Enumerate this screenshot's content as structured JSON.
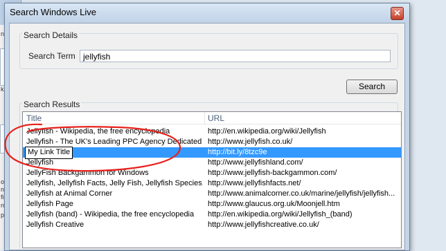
{
  "background_window": {
    "fragments": [
      "ndo",
      "k",
      "on",
      "ns",
      "fic",
      "ror",
      "pec"
    ]
  },
  "dialog": {
    "title": "Search Windows Live",
    "close_glyph": "✕"
  },
  "search_details": {
    "group_label": "Search Details",
    "term_label": "Search Term",
    "term_value": "jellyfish"
  },
  "search_button": {
    "label": "Search"
  },
  "search_results": {
    "group_label": "Search Results",
    "columns": [
      "Title",
      "URL"
    ],
    "rows": [
      {
        "title": "Jellyfish - Wikipedia, the free encyclopedia",
        "url": "http://en.wikipedia.org/wiki/Jellyfish"
      },
      {
        "title": "Jellyfish - The UK's Leading PPC Agency Dedicated to...",
        "url": "http://www.jellyfish.co.uk/"
      },
      {
        "title": "My Link Title",
        "url": "http://bit.ly/8tzc9e"
      },
      {
        "title": "Jellyfish",
        "url": "http://www.jellyfishland.com/"
      },
      {
        "title": "JellyFish Backgammon for Windows",
        "url": "http://www.jellyfish-backgammon.com/"
      },
      {
        "title": "Jellyfish, Jellyfish Facts, Jelly Fish, Jellyfish Species, J...",
        "url": "http://www.jellyfishfacts.net/"
      },
      {
        "title": "Jellyfish at Animal Corner",
        "url": "http://www.animalcorner.co.uk/marine/jellyfish/jellyfish..."
      },
      {
        "title": "Jellyfish Page",
        "url": "http://www.glaucus.org.uk/Moonjell.htm"
      },
      {
        "title": "Jellyfish (band) - Wikipedia, the free encyclopedia",
        "url": "http://en.wikipedia.org/wiki/Jellyfish_(band)"
      },
      {
        "title": "Jellyfish Creative",
        "url": "http://www.jellyfishcreative.co.uk/"
      }
    ],
    "selected_index": 2
  },
  "colors": {
    "selection": "#3399ff",
    "annotation": "#e8201a",
    "header_text": "#4c607a"
  }
}
